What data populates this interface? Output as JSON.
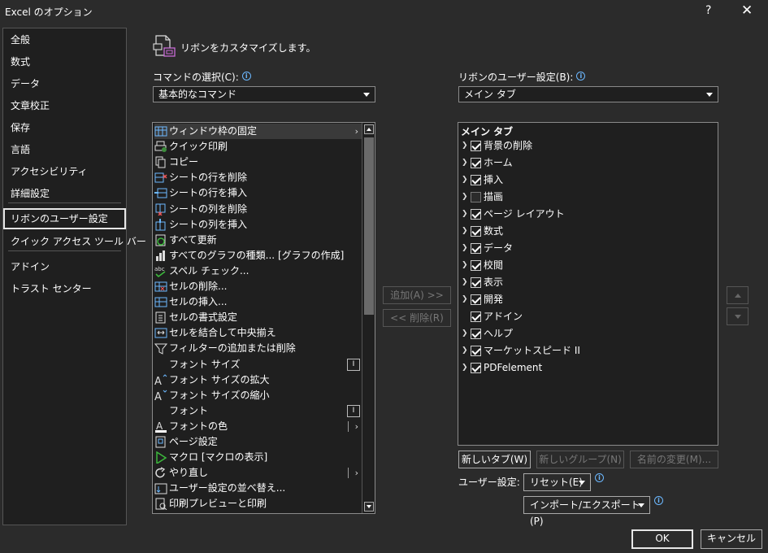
{
  "window": {
    "title": "Excel のオプション",
    "help": "?",
    "close": "✕"
  },
  "nav": {
    "items": [
      {
        "label": "全般"
      },
      {
        "label": "数式"
      },
      {
        "label": "データ"
      },
      {
        "label": "文章校正"
      },
      {
        "label": "保存"
      },
      {
        "label": "言語"
      },
      {
        "label": "アクセシビリティ"
      },
      {
        "label": "詳細設定"
      },
      {
        "label": "リボンのユーザー設定"
      },
      {
        "label": "クイック アクセス ツール バー"
      },
      {
        "label": "アドイン"
      },
      {
        "label": "トラスト センター"
      }
    ],
    "selected": "リボンのユーザー設定"
  },
  "header": {
    "text": "リボンをカスタマイズします。",
    "icon": "ribbon-customize-icon"
  },
  "commands": {
    "label": "コマンドの選択(C):",
    "selected": "基本的なコマンド",
    "items": [
      {
        "label": "ウィンドウ枠の固定",
        "icon": "freeze-panes-icon",
        "sub": "arrow"
      },
      {
        "label": "クイック印刷",
        "icon": "quick-print-icon"
      },
      {
        "label": "コピー",
        "icon": "copy-icon"
      },
      {
        "label": "シートの行を削除",
        "icon": "delete-row-icon"
      },
      {
        "label": "シートの行を挿入",
        "icon": "insert-row-icon"
      },
      {
        "label": "シートの列を削除",
        "icon": "delete-column-icon"
      },
      {
        "label": "シートの列を挿入",
        "icon": "insert-column-icon"
      },
      {
        "label": "すべて更新",
        "icon": "refresh-all-icon"
      },
      {
        "label": "すべてのグラフの種類... [グラフの作成]",
        "icon": "chart-types-icon"
      },
      {
        "label": "スペル チェック...",
        "icon": "spelling-icon"
      },
      {
        "label": "セルの削除...",
        "icon": "delete-cells-icon"
      },
      {
        "label": "セルの挿入...",
        "icon": "insert-cells-icon"
      },
      {
        "label": "セルの書式設定",
        "icon": "format-cells-icon"
      },
      {
        "label": "セルを結合して中央揃え",
        "icon": "merge-center-icon"
      },
      {
        "label": "フィルターの追加または削除",
        "icon": "filter-icon"
      },
      {
        "label": "フォント サイズ",
        "icon": "",
        "sub": "box"
      },
      {
        "label": "フォント サイズの拡大",
        "icon": "increase-font-icon"
      },
      {
        "label": "フォント サイズの縮小",
        "icon": "decrease-font-icon"
      },
      {
        "label": "フォント",
        "icon": "",
        "sub": "box"
      },
      {
        "label": "フォントの色",
        "icon": "font-color-icon",
        "sub": "bar-arrow"
      },
      {
        "label": "ページ設定",
        "icon": "page-setup-icon"
      },
      {
        "label": "マクロ [マクロの表示]",
        "icon": "macro-icon"
      },
      {
        "label": "やり直し",
        "icon": "redo-icon",
        "sub": "bar-arrow"
      },
      {
        "label": "ユーザー設定の並べ替え...",
        "icon": "custom-sort-icon"
      },
      {
        "label": "印刷プレビューと印刷",
        "icon": "print-preview-icon"
      }
    ]
  },
  "buttons": {
    "add": "追加(A) >>",
    "remove": "<< 削除(R)"
  },
  "ribbon": {
    "label": "リボンのユーザー設定(B):",
    "selected": "メイン タブ",
    "tree_header": "メイン タブ",
    "tabs": [
      {
        "label": "背景の削除",
        "checked": true,
        "expand": true
      },
      {
        "label": "ホーム",
        "checked": true,
        "expand": true
      },
      {
        "label": "挿入",
        "checked": true,
        "expand": true
      },
      {
        "label": "描画",
        "checked": false,
        "expand": true
      },
      {
        "label": "ページ レイアウト",
        "checked": true,
        "expand": true
      },
      {
        "label": "数式",
        "checked": true,
        "expand": true
      },
      {
        "label": "データ",
        "checked": true,
        "expand": true
      },
      {
        "label": "校閲",
        "checked": true,
        "expand": true
      },
      {
        "label": "表示",
        "checked": true,
        "expand": true
      },
      {
        "label": "開発",
        "checked": true,
        "expand": true
      },
      {
        "label": "アドイン",
        "checked": true,
        "expand": false
      },
      {
        "label": "ヘルプ",
        "checked": true,
        "expand": true
      },
      {
        "label": "マーケットスピード II",
        "checked": true,
        "expand": true
      },
      {
        "label": "PDFelement",
        "checked": true,
        "expand": true
      }
    ]
  },
  "ribbon_buttons": {
    "new_tab": "新しいタブ(W)",
    "new_group": "新しいグループ(N)",
    "rename": "名前の変更(M)..."
  },
  "customizations": {
    "label": "ユーザー設定:",
    "reset": "リセット(E)",
    "import_export": "インポート/エクスポート(P)"
  },
  "footer": {
    "ok": "OK",
    "cancel": "キャンセル"
  }
}
